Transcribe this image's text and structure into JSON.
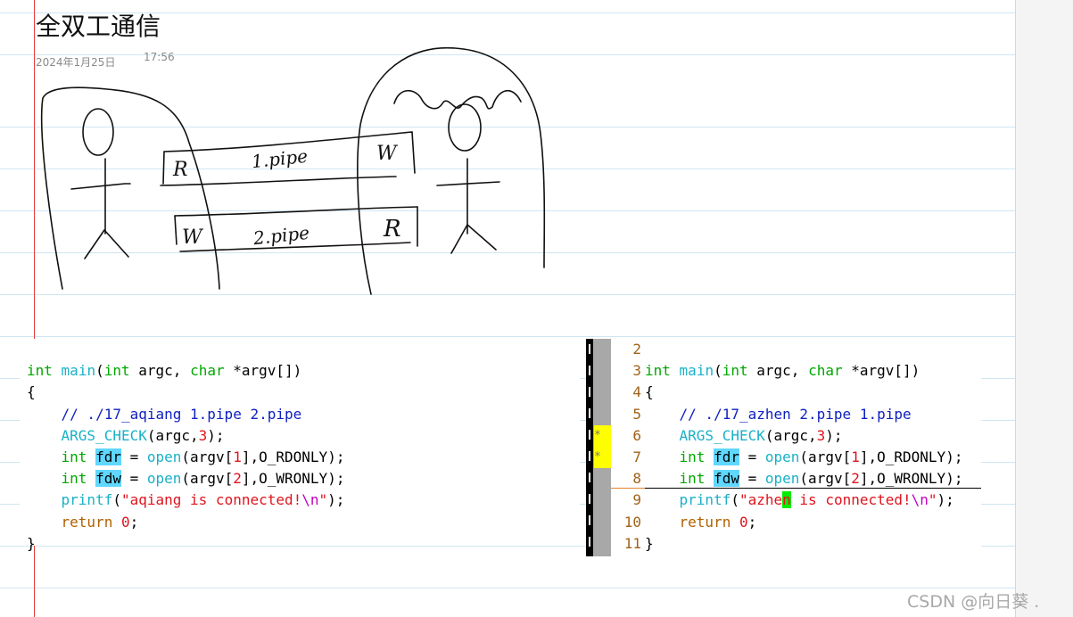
{
  "note": {
    "title": "全双工通信",
    "date": "2024年1月25日",
    "time": "17:56"
  },
  "sketch": {
    "pipe1_label": "1.pipe",
    "pipe2_label": "2.pipe",
    "pipe1_left": "R",
    "pipe1_right": "W",
    "pipe2_left": "W",
    "pipe2_right": "R"
  },
  "left_code": [
    "int main(int argc, char *argv[])",
    "{",
    "    // ./17_aqiang 1.pipe 2.pipe",
    "    ARGS_CHECK(argc,3);",
    "    int fdr = open(argv[1],O_RDONLY);",
    "    int fdw = open(argv[2],O_WRONLY);",
    "    printf(\"aqiang is connected!\\n\");",
    "    return 0;",
    "}"
  ],
  "right_code": {
    "line_numbers": [
      "2",
      "3",
      "4",
      "5",
      "6",
      "7",
      "8",
      "9",
      "10",
      "11"
    ],
    "lines": [
      "int main(int argc, char *argv[])",
      "{",
      "    // ./17_azhen 2.pipe 1.pipe",
      "    ARGS_CHECK(argc,3);",
      "    int fdr = open(argv[1],O_RDONLY);",
      "    int fdw = open(argv[2],O_WRONLY);",
      "    printf(\"azhen is connected!\\n\");",
      "    return 0;",
      "}",
      ""
    ],
    "sign_marks": [
      "*",
      "*"
    ]
  },
  "watermark": "CSDN @向日葵 ."
}
